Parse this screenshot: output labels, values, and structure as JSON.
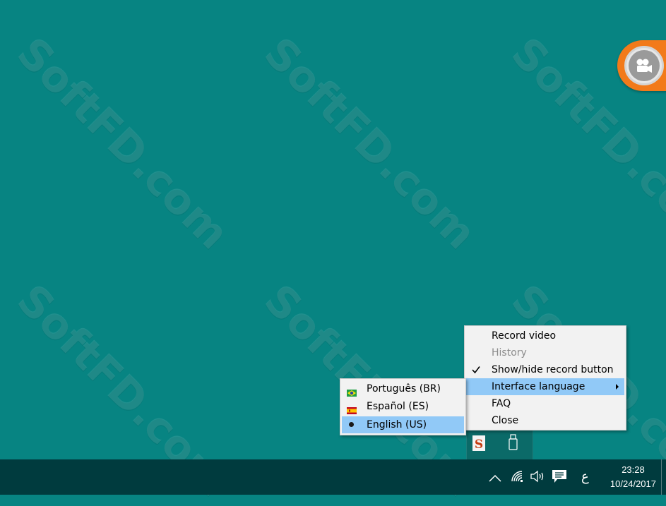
{
  "watermark": "SoftFD.com",
  "main_menu": {
    "items": [
      {
        "label": "Record video",
        "enabled": true,
        "checked": false
      },
      {
        "label": "History",
        "enabled": false,
        "checked": false
      },
      {
        "label": "Show/hide record button",
        "enabled": true,
        "checked": true
      },
      {
        "label": "Interface language",
        "enabled": true,
        "has_submenu": true,
        "highlighted": true
      },
      {
        "label": "FAQ",
        "enabled": true
      },
      {
        "label": "Close",
        "enabled": true
      }
    ]
  },
  "language_menu": {
    "items": [
      {
        "label": "Português (BR)",
        "flag": "brazil-flag",
        "selected": false
      },
      {
        "label": "Español (ES)",
        "flag": "spain-flag",
        "selected": false
      },
      {
        "label": "English (US)",
        "flag": "bullet",
        "selected": true
      }
    ]
  },
  "taskbar": {
    "time": "23:28",
    "date": "10/24/2017",
    "input_indicator": "ع",
    "icons": [
      "chevron-up-icon",
      "wifi-icon",
      "volume-icon",
      "notification-icon"
    ]
  },
  "colors": {
    "desktop": "#078482",
    "taskbar": "#003b3e",
    "menu_bg": "#f2f2f2",
    "highlight": "#91c9f7",
    "record_orange": "#f27a1a"
  }
}
